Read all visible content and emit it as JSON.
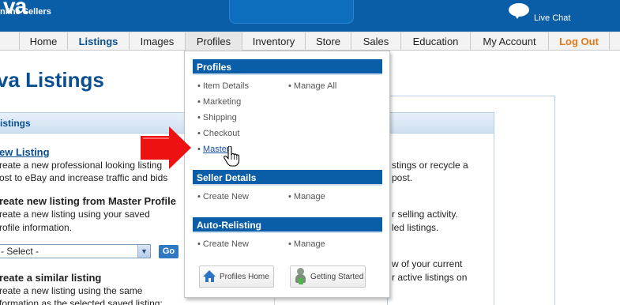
{
  "header": {
    "logo_text": "va",
    "tagline": "nline Sellers",
    "live_chat": "Live Chat"
  },
  "nav": {
    "items": [
      {
        "label": "Home"
      },
      {
        "label": "Listings"
      },
      {
        "label": "Images"
      },
      {
        "label": "Profiles"
      },
      {
        "label": "Inventory"
      },
      {
        "label": "Store"
      },
      {
        "label": "Sales"
      },
      {
        "label": "Education"
      },
      {
        "label": "My Account"
      },
      {
        "label": "Log Out"
      }
    ],
    "active": "Listings",
    "open": "Profiles"
  },
  "page": {
    "title": "va Listings",
    "box_heading": "istings",
    "new_listing_link": "ew Listing",
    "new_listing_desc1": "reate a new professional looking listing",
    "new_listing_desc2": "ost to eBay and increase traffic and bids",
    "master_heading": "reate new listing from Master Profile",
    "master_desc1": "reate a new listing using your saved",
    "master_desc2": "rofile information.",
    "select_value": "- Select -",
    "go_button": "Go",
    "similar_heading": "reate a similar listing",
    "similar_desc1": "reate a new listing using the same",
    "similar_desc2": "formation as the selected saved listing:",
    "right_text1": "stings or recycle a",
    "right_text2": "post.",
    "right_text3": "r selling activity.",
    "right_text4": "led listings.",
    "right_text5": "w of your current",
    "right_text6": "r active listings on"
  },
  "dropdown": {
    "profiles_heading": "Profiles",
    "profiles_items_left": [
      "Item Details",
      "Marketing",
      "Shipping",
      "Checkout",
      "Master"
    ],
    "profiles_items_right": [
      "Manage All"
    ],
    "seller_heading": "Seller Details",
    "seller_items": [
      "Create New",
      "Manage"
    ],
    "relisting_heading": "Auto-Relisting",
    "relisting_items": [
      "Create New",
      "Manage"
    ],
    "profiles_home_button": "Profiles Home",
    "getting_started_button": "Getting Started",
    "bullet": "•"
  },
  "colors": {
    "brand_blue": "#0a5ea8",
    "nav_active": "#0a4f8f",
    "logout_orange": "#e07a17",
    "arrow_red": "#ee1111"
  }
}
